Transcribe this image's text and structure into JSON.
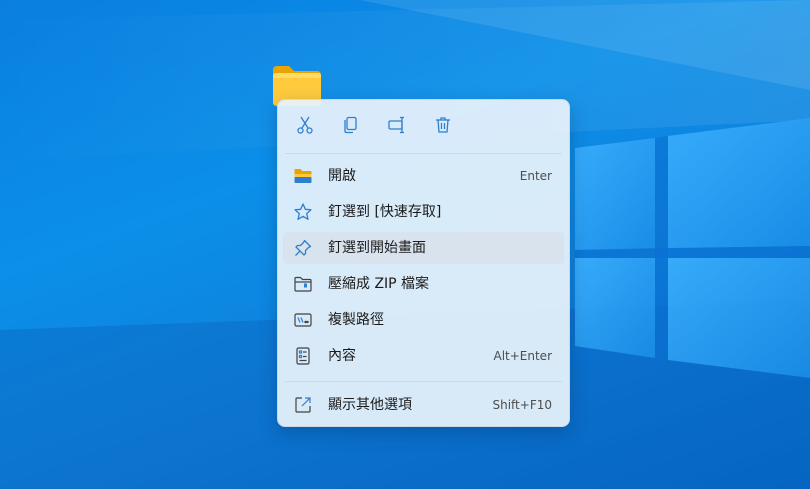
{
  "desktop": {
    "folder_icon": "folder-icon"
  },
  "menu": {
    "toolbar": [
      {
        "name": "cut-button",
        "icon": "scissors-icon"
      },
      {
        "name": "copy-button",
        "icon": "copy-icon"
      },
      {
        "name": "rename-button",
        "icon": "rename-icon"
      },
      {
        "name": "delete-button",
        "icon": "trash-icon"
      }
    ],
    "items": [
      {
        "label": "開啟",
        "accel": "Enter",
        "icon": "open-folder-icon"
      },
      {
        "label": "釘選到 [快速存取]",
        "accel": "",
        "icon": "star-icon"
      },
      {
        "label": "釘選到開始畫面",
        "accel": "",
        "icon": "pin-icon"
      },
      {
        "label": "壓縮成 ZIP 檔案",
        "accel": "",
        "icon": "zip-folder-icon"
      },
      {
        "label": "複製路徑",
        "accel": "",
        "icon": "path-icon"
      },
      {
        "label": "內容",
        "accel": "Alt+Enter",
        "icon": "properties-icon"
      },
      {
        "label": "顯示其他選項",
        "accel": "Shift+F10",
        "icon": "more-options-icon"
      }
    ]
  },
  "colors": {
    "accent": "#0f6cbd",
    "desktop": "#0b8fe8",
    "menu_bg": "#e8f2fb",
    "hover": "#d8e3ee"
  }
}
